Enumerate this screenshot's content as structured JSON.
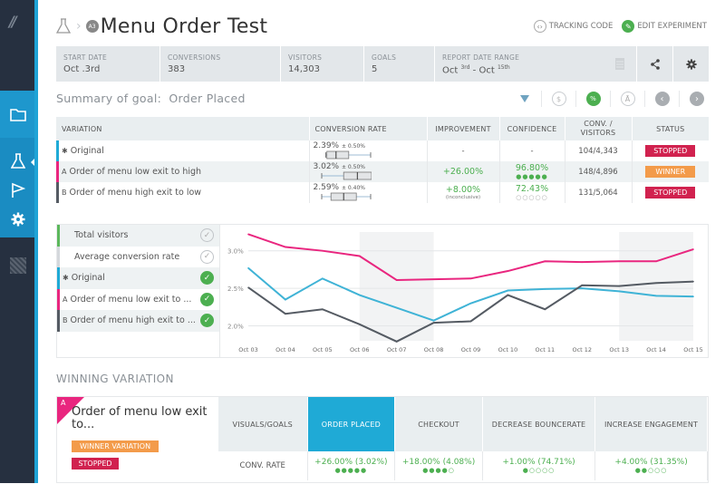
{
  "sidebar": {
    "items": [
      {
        "name": "folder",
        "icon": "folder-icon"
      },
      {
        "name": "experiments",
        "icon": "flask-icon",
        "active": true
      },
      {
        "name": "goals",
        "icon": "flag-icon"
      },
      {
        "name": "settings",
        "icon": "gear-icon"
      }
    ]
  },
  "header": {
    "badge": "A3",
    "title": "Menu Order Test",
    "tracking_code": "TRACKING CODE",
    "edit_experiment": "EDIT EXPERIMENT"
  },
  "stats": [
    {
      "label": "START DATE",
      "value": "Oct .3rd"
    },
    {
      "label": "CONVERSIONS",
      "value": "383"
    },
    {
      "label": "VISITORS",
      "value": "14,303"
    },
    {
      "label": "GOALS",
      "value": "5"
    }
  ],
  "report_range": {
    "label": "REPORT DATE RANGE",
    "from": "Oct",
    "from_sup": "3rd",
    "sep": " - ",
    "to": "Oct",
    "to_sup": "15th"
  },
  "summary": {
    "label": "Summary of goal:",
    "goal": "Order Placed"
  },
  "toolbar": {
    "dollar": "$",
    "percent": "%",
    "prev": "‹",
    "next": "›"
  },
  "variations_table": {
    "headers": [
      "VARIATION",
      "CONVERSION RATE",
      "IMPROVEMENT",
      "CONFIDENCE",
      "CONV. /",
      "VISITORS",
      "STATUS"
    ],
    "rows": [
      {
        "prefix": "✱",
        "name": "Original",
        "color": "#1faad6",
        "rate": "2.39%",
        "margin": "± 0.50%",
        "improvement": "-",
        "improvement_note": "",
        "confidence": "-",
        "confidence_dots": 0,
        "conv_visitors": "104/4,343",
        "status": "STOPPED",
        "box": [
          0.08,
          0.12,
          0.3,
          0.55,
          1.0
        ]
      },
      {
        "prefix": "A",
        "name": "Order of menu low exit to high",
        "color": "#e9267f",
        "rate": "3.02%",
        "margin": "± 0.50%",
        "improvement": "+26.00%",
        "improvement_note": "",
        "confidence": "96.80%",
        "confidence_dots": 5,
        "conv_visitors": "148/4,896",
        "status": "WINNER",
        "box": [
          0.0,
          0.45,
          0.72,
          1.0,
          1.0
        ]
      },
      {
        "prefix": "B",
        "name": "Order of menu high exit to low",
        "color": "#555b63",
        "rate": "2.59%",
        "margin": "± 0.40%",
        "improvement": "+8.00%",
        "improvement_note": "(inconclusive)",
        "confidence": "72.43%",
        "confidence_dots": 0,
        "conv_visitors": "131/5,064",
        "status": "STOPPED",
        "box": [
          0.0,
          0.2,
          0.45,
          0.7,
          1.0
        ]
      }
    ]
  },
  "legend": [
    {
      "prefix": "",
      "label": "Total visitors",
      "color": "#5cb85c",
      "checked": false
    },
    {
      "prefix": "",
      "label": "Average conversion rate",
      "color": "#d4d8dc",
      "checked": false
    },
    {
      "prefix": "✱",
      "label": "Original",
      "color": "#1faad6",
      "checked": true
    },
    {
      "prefix": "A",
      "label": "Order of menu low exit to ...",
      "color": "#e9267f",
      "checked": true
    },
    {
      "prefix": "B",
      "label": "Order of menu high exit to ...",
      "color": "#555b63",
      "checked": true
    }
  ],
  "chart_data": {
    "type": "line",
    "title": "",
    "xlabel": "",
    "ylabel": "",
    "x": [
      "Oct 03",
      "Oct 04",
      "Oct 05",
      "Oct 06",
      "Oct 07",
      "Oct 08",
      "Oct 09",
      "Oct 10",
      "Oct 11",
      "Oct 12",
      "Oct 13",
      "Oct 14",
      "Oct 15"
    ],
    "ylim": [
      1.8,
      3.25
    ],
    "yticks": [
      2.0,
      2.5,
      3.0
    ],
    "ytick_labels": [
      "2.0%",
      "2.5%",
      "3.0%"
    ],
    "grid": true,
    "shaded_ranges": [
      [
        "Oct 06",
        "Oct 08"
      ],
      [
        "Oct 13",
        "Oct 15"
      ]
    ],
    "series": [
      {
        "name": "Order of menu low exit to high",
        "color": "#e9267f",
        "values": [
          3.22,
          3.05,
          3.0,
          2.93,
          2.61,
          2.62,
          2.63,
          2.73,
          2.86,
          2.85,
          2.86,
          2.86,
          3.02
        ]
      },
      {
        "name": "Original",
        "color": "#3fb3d6",
        "values": [
          2.77,
          2.35,
          2.63,
          2.41,
          2.24,
          2.07,
          2.3,
          2.47,
          2.49,
          2.5,
          2.46,
          2.4,
          2.39
        ]
      },
      {
        "name": "Order of menu high exit to low",
        "color": "#555b63",
        "values": [
          2.51,
          2.16,
          2.22,
          2.02,
          1.79,
          2.04,
          2.06,
          2.41,
          2.22,
          2.54,
          2.53,
          2.57,
          2.59
        ]
      }
    ]
  },
  "winning": {
    "section_title": "WINNING VARIATION",
    "prefix": "A",
    "name": "Order of menu low exit to...",
    "winner_label": "WINNER VARIATION",
    "status_label": "STOPPED",
    "goals_header": "VISUALS/GOALS",
    "row_label": "CONV. RATE",
    "goals": [
      {
        "name": "ORDER PLACED",
        "value": "+26.00%  (3.02%)",
        "dots": 5,
        "highlight": true
      },
      {
        "name": "CHECKOUT",
        "value": "+18.00%  (4.08%)",
        "dots": 4,
        "highlight": false
      },
      {
        "name": "DECREASE BOUNCERATE",
        "value": "+1.00%  (74.71%)",
        "dots": 1,
        "highlight": false
      },
      {
        "name": "INCREASE ENGAGEMENT",
        "value": "+4.00%  (31.35%)",
        "dots": 2,
        "highlight": false
      }
    ]
  }
}
